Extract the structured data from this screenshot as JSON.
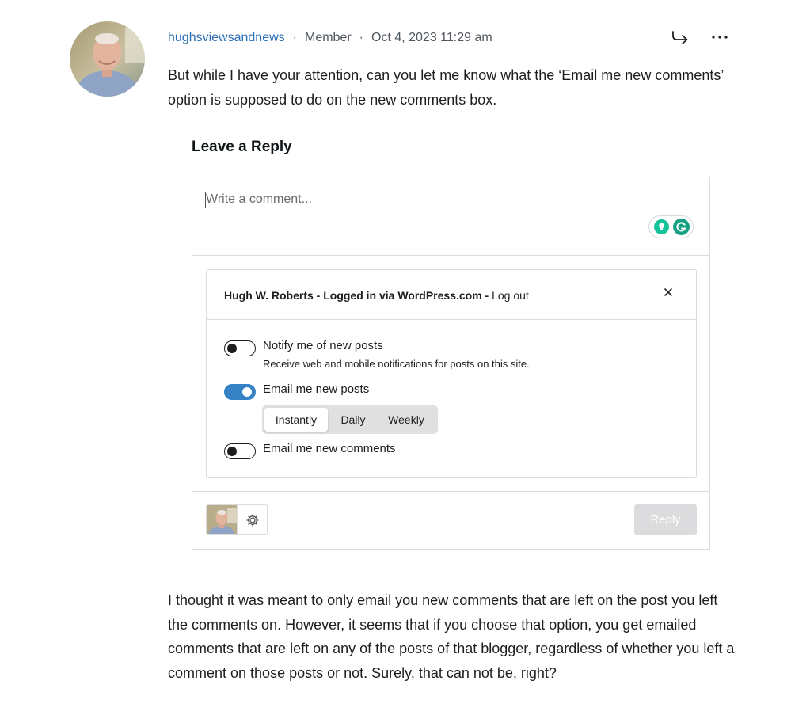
{
  "comment": {
    "author": "hughsviewsandnews",
    "role": "Member",
    "date": "Oct 4, 2023 11:29 am",
    "separator": "·",
    "paragraph_1": "But while I have your attention, can you let me know what the ‘Email me new comments’ option is supposed to do on the new comments box.",
    "paragraph_2": "I thought it was meant to only email you new comments that are left on the post you left the comments on. However, it seems that if you choose that option, you get emailed comments that are left on any of the posts of that blogger, regardless of whether you left a comment on those posts or not. Surely, that can not be, right?"
  },
  "reply_form": {
    "heading": "Leave a Reply",
    "placeholder": "Write a comment...",
    "login_text": "Hugh W. Roberts - Logged in via WordPress.com - ",
    "logout_label": "Log out",
    "options": {
      "notify_posts": {
        "label": "Notify me of new posts",
        "description": "Receive web and mobile notifications for posts on this site.",
        "enabled": false
      },
      "email_posts": {
        "label": "Email me new posts",
        "enabled": true
      },
      "email_comments": {
        "label": "Email me new comments",
        "enabled": false
      }
    },
    "frequency": {
      "options": [
        "Instantly",
        "Daily",
        "Weekly"
      ],
      "selected": "Instantly"
    },
    "reply_label": "Reply"
  },
  "icons": {
    "reply": "reply-arrow-icon",
    "more": "more-dots-icon",
    "close": "close-icon",
    "settings": "gear-icon",
    "grammarly": "grammarly-icon"
  },
  "colors": {
    "author_link": "#2c6fb7",
    "toggle_on": "#3582c4",
    "reply_button_disabled": "#dcdcde",
    "grammarly": "#15c39a"
  }
}
